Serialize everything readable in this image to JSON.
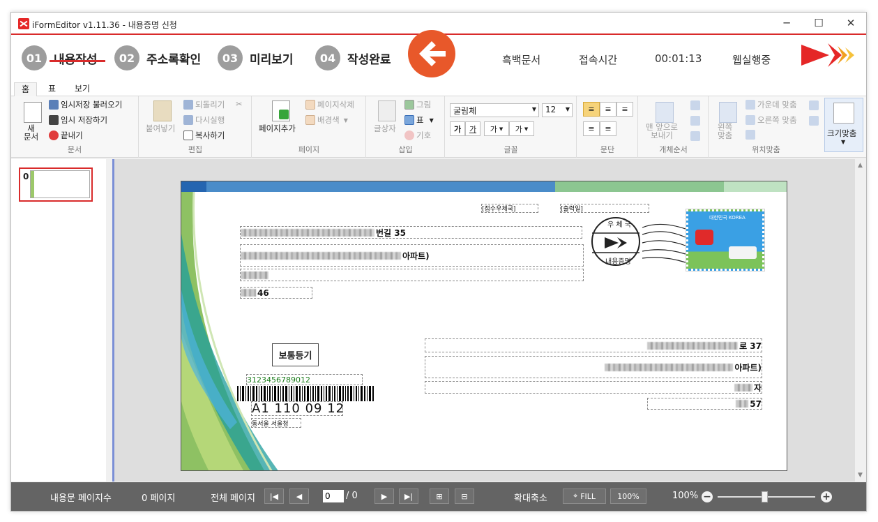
{
  "window": {
    "title": "iFormEditor v1.11.36 - 내용증명 신청",
    "minimize": "─",
    "maximize": "☐",
    "close": "✕"
  },
  "steps": [
    {
      "num": "01",
      "label": "내용작성"
    },
    {
      "num": "02",
      "label": "주소록확인"
    },
    {
      "num": "03",
      "label": "미리보기"
    },
    {
      "num": "04",
      "label": "작성완료"
    }
  ],
  "status": {
    "mode": "흑백문서",
    "conn_label": "접속시간",
    "conn_time": "00:01:13",
    "web_status": "웹실행중"
  },
  "ribbon_tabs": [
    "홈",
    "표",
    "보기"
  ],
  "ribbon": {
    "doc": {
      "new": "새\n문서",
      "load_temp": "임시저장 불러오기",
      "save_temp": "임시 저장하기",
      "exit": "끝내기",
      "label": "문서"
    },
    "edit": {
      "paste": "붙여넣기",
      "undo": "되돌리기",
      "redo": "다시실행",
      "copy": "복사하기",
      "label": "편집"
    },
    "page": {
      "add": "페이지추가",
      "delete": "페이지삭제",
      "bg": "배경색",
      "label": "페이지"
    },
    "insert": {
      "textbox": "글상자",
      "image": "그림",
      "table": "표",
      "symbol": "기호",
      "label": "삽입"
    },
    "font": {
      "name": "굴림체",
      "size": "12",
      "bold": "가",
      "underline": "가",
      "color": "가",
      "highlight": "가",
      "label": "글꼴"
    },
    "para": {
      "label": "문단"
    },
    "order": {
      "front": "맨 앞으로\n보내기",
      "label": "개체순서"
    },
    "align": {
      "left": "왼쪽\n맞춤",
      "center": "가운데 맞춤",
      "right": "오른쪽 맞춤",
      "label": "위치맞춤"
    },
    "fit": {
      "label": "크기맞춤"
    }
  },
  "thumbnails": [
    {
      "num": "0"
    }
  ],
  "envelope": {
    "postal_label": "[접수우체국]",
    "date_label": "[출력일]",
    "sender_line1": "번길 35",
    "sender_line2": "아파트)",
    "sender_line4": "46",
    "stamp_top": "우 체 국",
    "stamp_bottom": "내용증명",
    "postage_country": "대한민국 KOREA",
    "registered": "보통등기",
    "tracking_no": "3123456789012",
    "barcode_text": "A1 110 09 12",
    "barcode_sub": "동서울 서울청",
    "recipient_line1": "로 37",
    "recipient_line2": "아파트)",
    "recipient_line3": "자",
    "recipient_line4": "57"
  },
  "statusbar": {
    "pages_label": "내용문 페이지수",
    "pages_value": "0 페이지",
    "total_label": "전체 페이지",
    "current_page": "0",
    "total_pages": "/ 0",
    "zoom_label": "확대축소",
    "fill_btn": "FILL",
    "hundred_btn": "100%",
    "zoom_value": "100%"
  },
  "colors": {
    "accent_red": "#d92b2b",
    "step_gray": "#9d9d9d",
    "arrow_orange": "#e8582a",
    "statusbar_bg": "#646464"
  }
}
